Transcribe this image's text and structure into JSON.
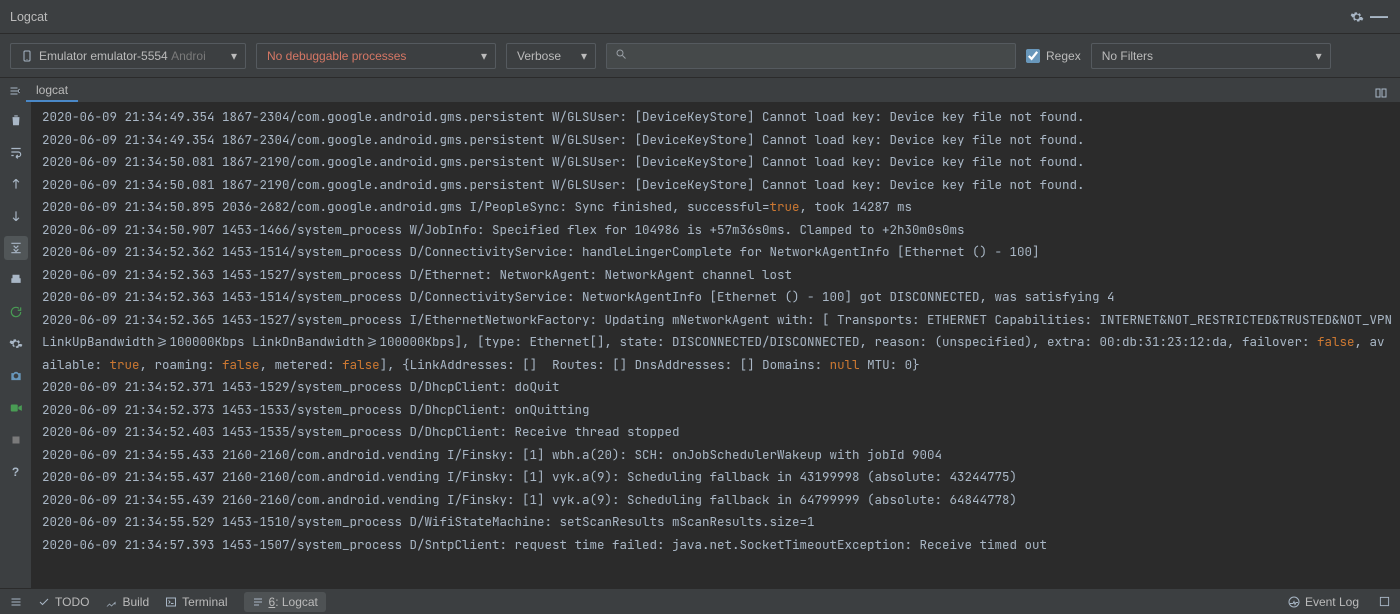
{
  "titlebar": {
    "title": "Logcat"
  },
  "filter": {
    "device": {
      "prefix_icon": "device-icon",
      "main": "Emulator emulator-5554",
      "suffix": "Androi"
    },
    "process": {
      "label": "No debuggable processes"
    },
    "level": {
      "label": "Verbose"
    },
    "search_placeholder": "",
    "regex_label": "Regex",
    "regex_checked": true,
    "filters": {
      "label": "No Filters"
    }
  },
  "tabs": {
    "active": "logcat",
    "items": [
      {
        "id": "logcat",
        "label": "logcat"
      }
    ]
  },
  "sidebar_icons": [
    "trash-icon",
    "wrap-icon",
    "arrow-up-icon",
    "arrow-down-icon",
    "scroll-end-icon",
    "print-icon",
    "refresh-icon",
    "gear-icon",
    "camera-icon",
    "record-icon",
    "stop-icon",
    "help-icon"
  ],
  "log_lines": [
    "2020-06-09 21:34:49.354 1867-2304/com.google.android.gms.persistent W/GLSUser: [DeviceKeyStore] Cannot load key: Device key file not found.",
    "2020-06-09 21:34:49.354 1867-2304/com.google.android.gms.persistent W/GLSUser: [DeviceKeyStore] Cannot load key: Device key file not found.",
    "2020-06-09 21:34:50.081 1867-2190/com.google.android.gms.persistent W/GLSUser: [DeviceKeyStore] Cannot load key: Device key file not found.",
    "2020-06-09 21:34:50.081 1867-2190/com.google.android.gms.persistent W/GLSUser: [DeviceKeyStore] Cannot load key: Device key file not found.",
    "2020-06-09 21:34:50.895 2036-2682/com.google.android.gms I/PeopleSync: Sync finished, successful=true, took 14287 ms",
    "2020-06-09 21:34:50.907 1453-1466/system_process W/JobInfo: Specified flex for 104986 is +57m36s0ms. Clamped to +2h30m0s0ms",
    "2020-06-09 21:34:52.362 1453-1514/system_process D/ConnectivityService: handleLingerComplete for NetworkAgentInfo [Ethernet () - 100]",
    "2020-06-09 21:34:52.363 1453-1527/system_process D/Ethernet: NetworkAgent: NetworkAgent channel lost",
    "2020-06-09 21:34:52.363 1453-1514/system_process D/ConnectivityService: NetworkAgentInfo [Ethernet () - 100] got DISCONNECTED, was satisfying 4",
    "2020-06-09 21:34:52.365 1453-1527/system_process I/EthernetNetworkFactory: Updating mNetworkAgent with: [ Transports: ETHERNET Capabilities: INTERNET&NOT_RESTRICTED&TRUSTED&NOT_VPN LinkUpBandwidth>=100000Kbps LinkDnBandwidth>=100000Kbps], [type: Ethernet[], state: DISCONNECTED/DISCONNECTED, reason: (unspecified), extra: 00:db:31:23:12:da, failover: false, available: true, roaming: false, metered: false], {LinkAddresses: []  Routes: [] DnsAddresses: [] Domains: null MTU: 0}",
    "2020-06-09 21:34:52.371 1453-1529/system_process D/DhcpClient: doQuit",
    "2020-06-09 21:34:52.373 1453-1533/system_process D/DhcpClient: onQuitting",
    "2020-06-09 21:34:52.403 1453-1535/system_process D/DhcpClient: Receive thread stopped",
    "2020-06-09 21:34:55.433 2160-2160/com.android.vending I/Finsky: [1] wbh.a(20): SCH: onJobSchedulerWakeup with jobId 9004",
    "2020-06-09 21:34:55.437 2160-2160/com.android.vending I/Finsky: [1] vyk.a(9): Scheduling fallback in 43199998 (absolute: 43244775)",
    "2020-06-09 21:34:55.439 2160-2160/com.android.vending I/Finsky: [1] vyk.a(9): Scheduling fallback in 64799999 (absolute: 64844778)",
    "2020-06-09 21:34:55.529 1453-1510/system_process D/WifiStateMachine: setScanResults mScanResults.size=1",
    "2020-06-09 21:34:57.393 1453-1507/system_process D/SntpClient: request time failed: java.net.SocketTimeoutException: Receive timed out"
  ],
  "bottom": {
    "todo": "TODO",
    "build": "Build",
    "terminal": "Terminal",
    "logcat": "6: Logcat",
    "eventlog": "Event Log"
  }
}
